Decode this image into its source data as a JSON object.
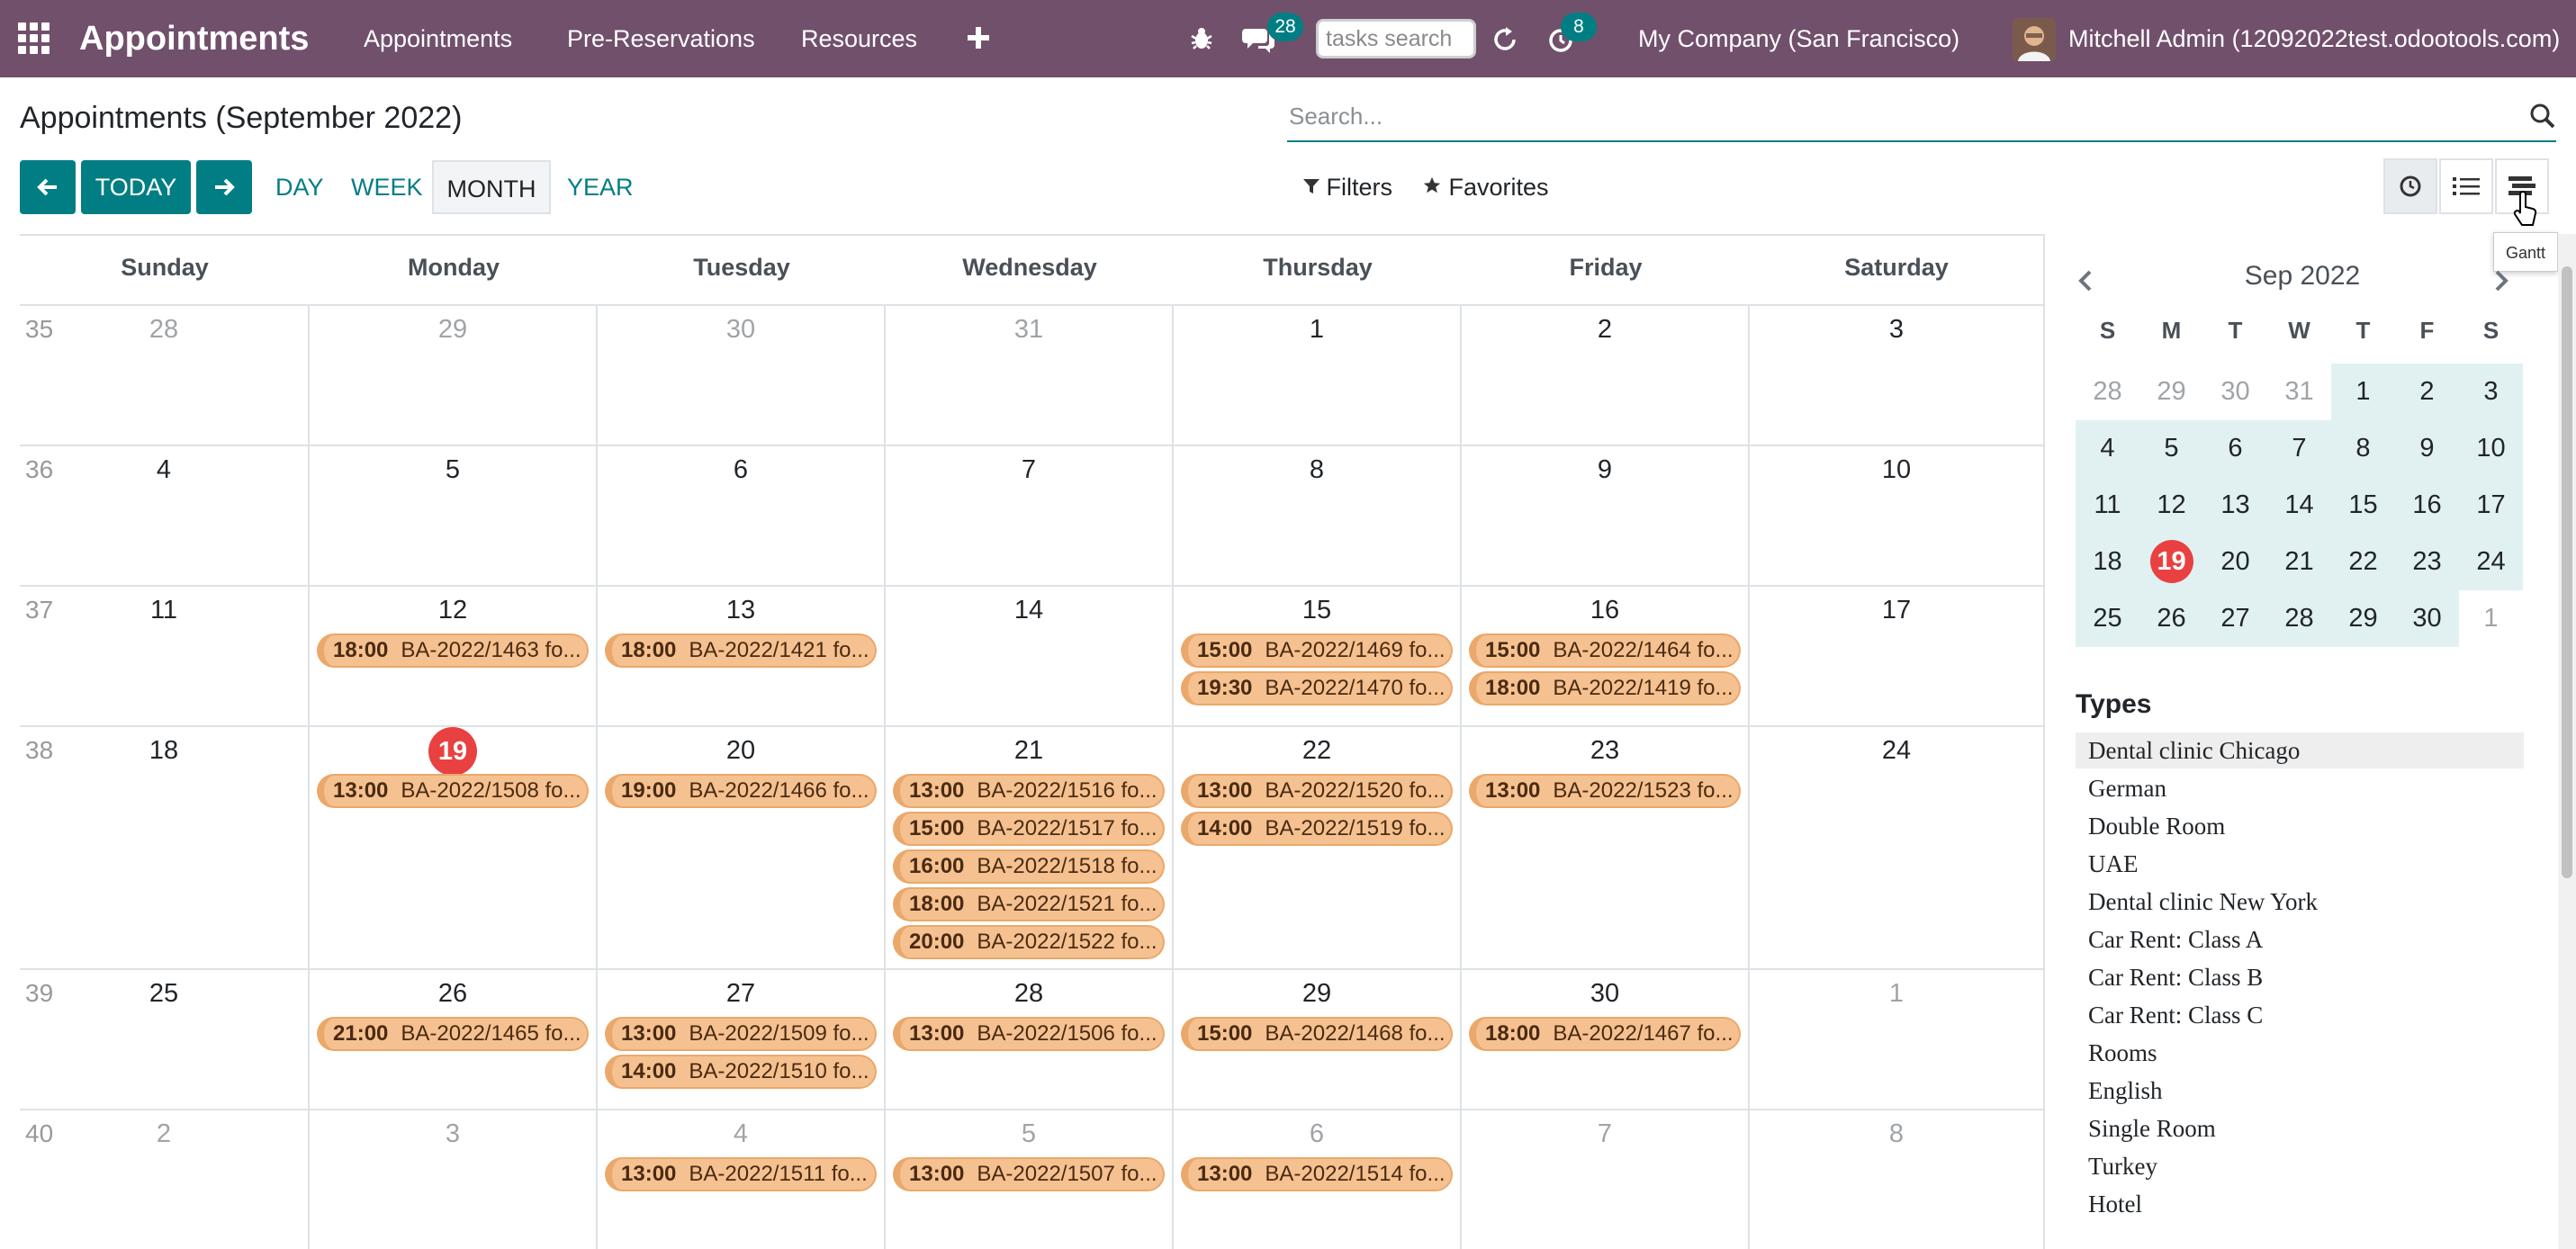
{
  "navbar": {
    "brand": "Appointments",
    "menu": [
      "Appointments",
      "Pre-Reservations",
      "Resources"
    ],
    "messages_count": "28",
    "activities_count": "8",
    "tasks_search_placeholder": "tasks search",
    "company": "My Company (San Francisco)",
    "user": "Mitchell Admin (12092022test.odootools.com)"
  },
  "control_panel": {
    "title": "Appointments (September 2022)",
    "search_placeholder": "Search...",
    "today_label": "TODAY",
    "scales": [
      "DAY",
      "WEEK",
      "MONTH",
      "YEAR"
    ],
    "active_scale": "MONTH",
    "filters_label": "Filters",
    "favorites_label": "Favorites",
    "tooltip": "Gantt"
  },
  "calendar": {
    "weekdays": [
      "Sunday",
      "Monday",
      "Tuesday",
      "Wednesday",
      "Thursday",
      "Friday",
      "Saturday"
    ],
    "weeks": [
      {
        "number": "35",
        "days": [
          {
            "day": "28",
            "muted": true,
            "events": []
          },
          {
            "day": "29",
            "muted": true,
            "events": []
          },
          {
            "day": "30",
            "muted": true,
            "events": []
          },
          {
            "day": "31",
            "muted": true,
            "events": []
          },
          {
            "day": "1",
            "events": []
          },
          {
            "day": "2",
            "events": []
          },
          {
            "day": "3",
            "events": []
          }
        ]
      },
      {
        "number": "36",
        "days": [
          {
            "day": "4",
            "events": []
          },
          {
            "day": "5",
            "events": []
          },
          {
            "day": "6",
            "events": []
          },
          {
            "day": "7",
            "events": []
          },
          {
            "day": "8",
            "events": []
          },
          {
            "day": "9",
            "events": []
          },
          {
            "day": "10",
            "events": []
          }
        ]
      },
      {
        "number": "37",
        "days": [
          {
            "day": "11",
            "events": []
          },
          {
            "day": "12",
            "events": [
              {
                "time": "18:00",
                "title": "BA-2022/1463 fo..."
              }
            ]
          },
          {
            "day": "13",
            "events": [
              {
                "time": "18:00",
                "title": "BA-2022/1421 fo..."
              }
            ]
          },
          {
            "day": "14",
            "events": []
          },
          {
            "day": "15",
            "events": [
              {
                "time": "15:00",
                "title": "BA-2022/1469 fo..."
              },
              {
                "time": "19:30",
                "title": "BA-2022/1470 fo..."
              }
            ]
          },
          {
            "day": "16",
            "events": [
              {
                "time": "15:00",
                "title": "BA-2022/1464 fo..."
              },
              {
                "time": "18:00",
                "title": "BA-2022/1419 fo..."
              }
            ]
          },
          {
            "day": "17",
            "events": []
          }
        ]
      },
      {
        "number": "38",
        "days": [
          {
            "day": "18",
            "events": []
          },
          {
            "day": "19",
            "today": true,
            "events": [
              {
                "time": "13:00",
                "title": "BA-2022/1508 fo..."
              }
            ]
          },
          {
            "day": "20",
            "events": [
              {
                "time": "19:00",
                "title": "BA-2022/1466 fo..."
              }
            ]
          },
          {
            "day": "21",
            "events": [
              {
                "time": "13:00",
                "title": "BA-2022/1516 fo..."
              },
              {
                "time": "15:00",
                "title": "BA-2022/1517 fo..."
              },
              {
                "time": "16:00",
                "title": "BA-2022/1518 fo..."
              },
              {
                "time": "18:00",
                "title": "BA-2022/1521 fo..."
              },
              {
                "time": "20:00",
                "title": "BA-2022/1522 fo..."
              }
            ]
          },
          {
            "day": "22",
            "events": [
              {
                "time": "13:00",
                "title": "BA-2022/1520 fo..."
              },
              {
                "time": "14:00",
                "title": "BA-2022/1519 fo..."
              }
            ]
          },
          {
            "day": "23",
            "events": [
              {
                "time": "13:00",
                "title": "BA-2022/1523 fo..."
              }
            ]
          },
          {
            "day": "24",
            "events": []
          }
        ]
      },
      {
        "number": "39",
        "days": [
          {
            "day": "25",
            "events": []
          },
          {
            "day": "26",
            "events": [
              {
                "time": "21:00",
                "title": "BA-2022/1465 fo..."
              }
            ]
          },
          {
            "day": "27",
            "events": [
              {
                "time": "13:00",
                "title": "BA-2022/1509 fo..."
              },
              {
                "time": "14:00",
                "title": "BA-2022/1510 fo..."
              }
            ]
          },
          {
            "day": "28",
            "events": [
              {
                "time": "13:00",
                "title": "BA-2022/1506 fo..."
              }
            ]
          },
          {
            "day": "29",
            "events": [
              {
                "time": "15:00",
                "title": "BA-2022/1468 fo..."
              }
            ]
          },
          {
            "day": "30",
            "events": [
              {
                "time": "18:00",
                "title": "BA-2022/1467 fo..."
              }
            ]
          },
          {
            "day": "1",
            "muted": true,
            "events": []
          }
        ]
      },
      {
        "number": "40",
        "days": [
          {
            "day": "2",
            "muted": true,
            "events": []
          },
          {
            "day": "3",
            "muted": true,
            "events": []
          },
          {
            "day": "4",
            "muted": true,
            "events": [
              {
                "time": "13:00",
                "title": "BA-2022/1511 fo..."
              }
            ]
          },
          {
            "day": "5",
            "muted": true,
            "events": [
              {
                "time": "13:00",
                "title": "BA-2022/1507 fo..."
              }
            ]
          },
          {
            "day": "6",
            "muted": true,
            "events": [
              {
                "time": "13:00",
                "title": "BA-2022/1514 fo..."
              }
            ]
          },
          {
            "day": "7",
            "muted": true,
            "events": []
          },
          {
            "day": "8",
            "muted": true,
            "events": []
          }
        ]
      }
    ]
  },
  "mini_calendar": {
    "month_label": "Sep 2022",
    "weekday_initials": [
      "S",
      "M",
      "T",
      "W",
      "T",
      "F",
      "S"
    ],
    "weeks": [
      [
        "28",
        "29",
        "30",
        "31",
        "1",
        "2",
        "3"
      ],
      [
        "4",
        "5",
        "6",
        "7",
        "8",
        "9",
        "10"
      ],
      [
        "11",
        "12",
        "13",
        "14",
        "15",
        "16",
        "17"
      ],
      [
        "18",
        "19",
        "20",
        "21",
        "22",
        "23",
        "24"
      ],
      [
        "25",
        "26",
        "27",
        "28",
        "29",
        "30",
        "1"
      ]
    ],
    "today": "19"
  },
  "types": {
    "title": "Types",
    "items": [
      "Dental clinic Chicago",
      "German",
      "Double Room",
      "UAE",
      "Dental clinic New York",
      "Car Rent: Class A",
      "Car Rent: Class B",
      "Car Rent: Class C",
      "Rooms",
      "English",
      "Single Room",
      "Turkey",
      "Hotel"
    ]
  },
  "colors": {
    "navbar": "#71506b",
    "primary": "#017e84",
    "event_fill": "#f5c190",
    "today": "#e94141"
  }
}
